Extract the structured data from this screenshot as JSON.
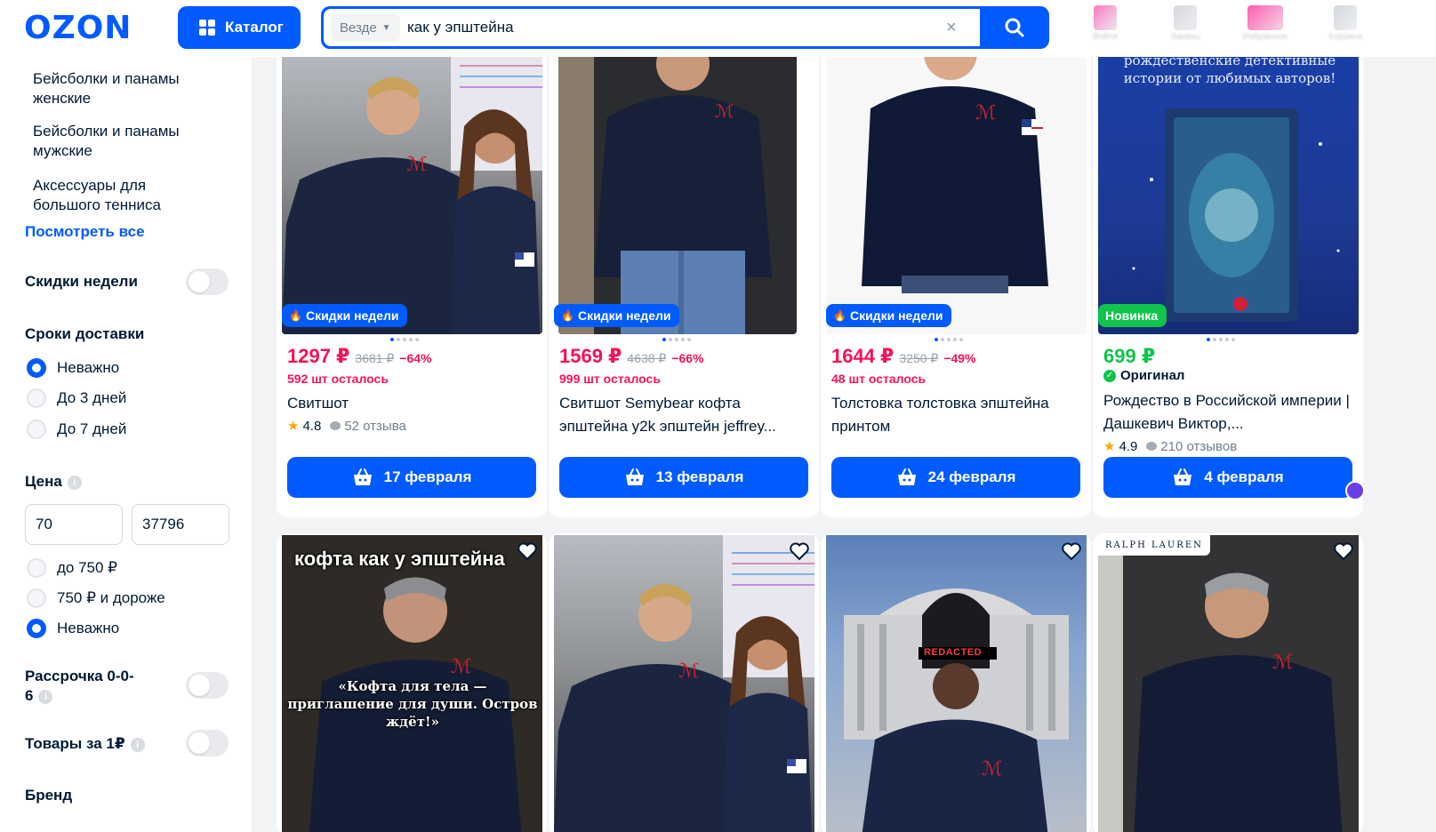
{
  "header": {
    "logo": "OZON",
    "catalog_label": "Каталог",
    "search_scope": "Везде",
    "search_query": "как у эпштейна",
    "colors": {
      "brand": "#005bff",
      "price": "#f91155",
      "new": "#10c44c"
    },
    "icons": [
      "user-icon",
      "orders-icon",
      "favorites-icon",
      "cart-icon"
    ]
  },
  "sidebar": {
    "categories": [
      "Бейсболки и панамы женские",
      "Бейсболки и панамы мужские",
      "Аксессуары для большого тенниса"
    ],
    "see_all": "Посмотреть все",
    "week_discounts": "Скидки недели",
    "delivery_title": "Сроки доставки",
    "delivery_options": [
      "Неважно",
      "До 3 дней",
      "До 7 дней"
    ],
    "delivery_selected": "Неважно",
    "price_title": "Цена",
    "price_from": "70",
    "price_to": "37796",
    "price_options": [
      "до 750 ₽",
      "750 ₽ и дороже",
      "Неважно"
    ],
    "price_selected": "Неважно",
    "installment": "Рассрочка 0-0-6",
    "one_ruble": "Товары за 1₽",
    "brand_title": "Бренд"
  },
  "products_row1": [
    {
      "badge": "Скидки недели",
      "price": "1297 ₽",
      "old_price": "3681 ₽",
      "discount": "−64%",
      "stock": "592 шт осталось",
      "title": "Свитшот",
      "rating": "4.8",
      "reviews": "52 отзыва",
      "delivery": "17 февраля"
    },
    {
      "badge": "Скидки недели",
      "price": "1569 ₽",
      "old_price": "4638 ₽",
      "discount": "−66%",
      "stock": "999 шт осталось",
      "title": "Свитшот Semybear кофта эпштейна y2k эпштейн jeffrey...",
      "delivery": "13 февраля"
    },
    {
      "badge": "Скидки недели",
      "price": "1644 ₽",
      "old_price": "3250 ₽",
      "discount": "−49%",
      "stock": "48 шт осталось",
      "title": "Толстовка толстовка эпштейна принтом",
      "delivery": "24 февраля"
    },
    {
      "badge": "Новинка",
      "price": "699 ₽",
      "original": "Оригинал",
      "title": "Рождество в Российской империи | Дашкевич Виктор,...",
      "rating": "4.9",
      "reviews": "210 отзывов",
      "delivery": "4 февраля",
      "book_banner": "рождественские детективные истории от любимых авторов!"
    }
  ],
  "products_row2": [
    {
      "overlay_title": "кофта как у эпштейна",
      "overlay_quote": "«Кофта для тела — приглашение для души. Остров ждёт!»"
    },
    {},
    {
      "redacted_label": "REDACTED"
    },
    {
      "brand_tag": "RALPH LAUREN"
    }
  ]
}
